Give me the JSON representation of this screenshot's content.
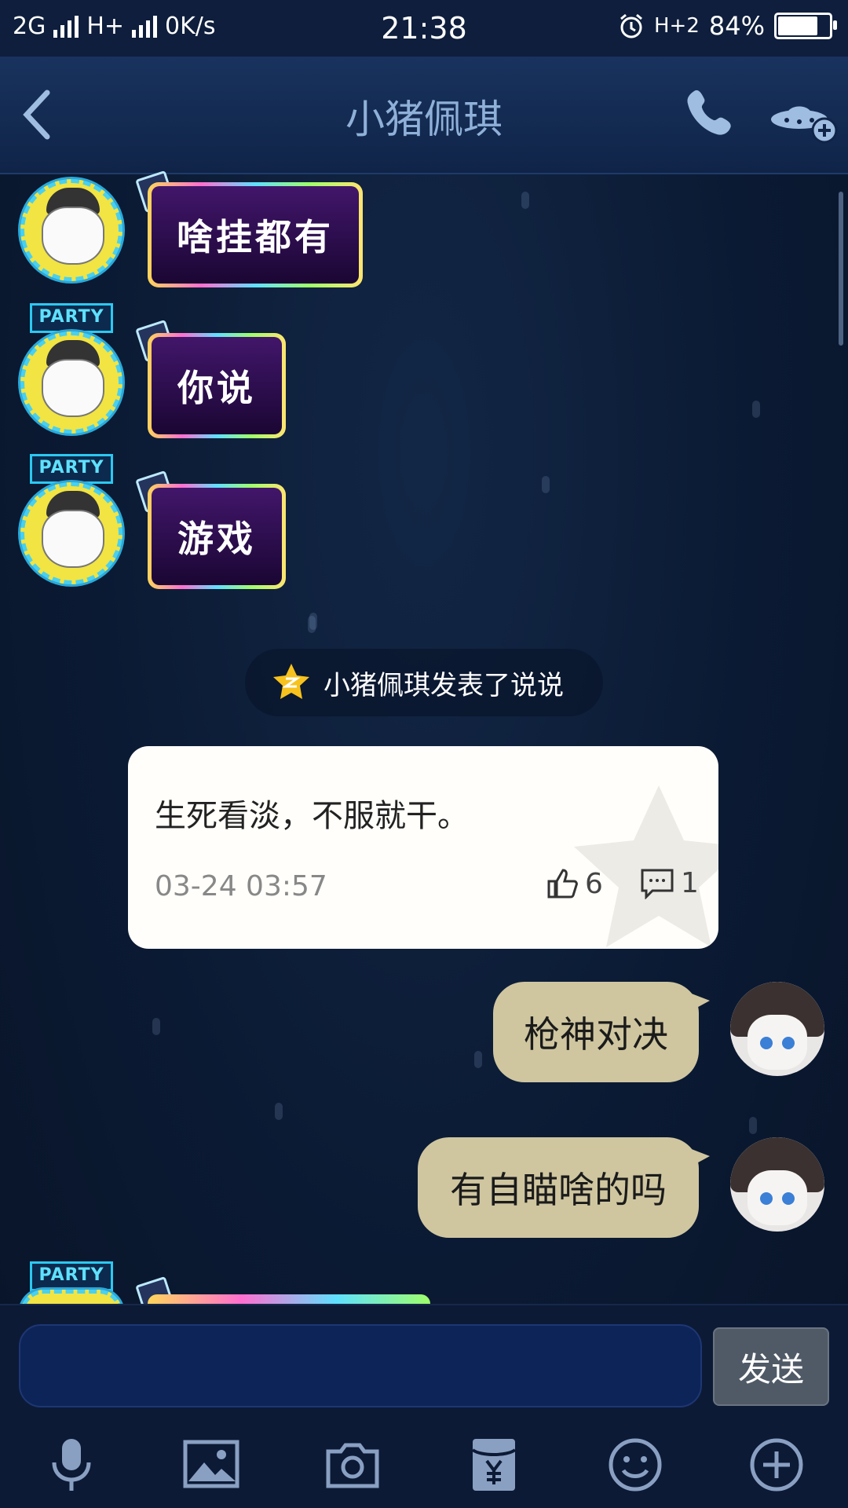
{
  "status_bar": {
    "network1": "2G",
    "network2": "H+",
    "speed": "0K/s",
    "time": "21:38",
    "network3": "H+2",
    "battery": "84%",
    "battery_level": 0.84
  },
  "header": {
    "title": "小猪佩琪",
    "back_icon": "chevron-left-icon",
    "call_icon": "phone-icon",
    "more_icon": "ufo-add-icon"
  },
  "messages": [
    {
      "side": "left",
      "badge": "",
      "text": "啥挂都有"
    },
    {
      "side": "left",
      "badge": "PARTY",
      "text": "你说"
    },
    {
      "side": "left",
      "badge": "PARTY",
      "text": "游戏"
    }
  ],
  "notice": {
    "text": "小猪佩琪发表了说说",
    "icon": "qzone-star-icon"
  },
  "shuoshuo": {
    "text": "生死看淡，不服就干。",
    "time": "03-24 03:57",
    "likes": "6",
    "comments": "1"
  },
  "my_messages": [
    {
      "text": "枪神对决"
    },
    {
      "text": "有自瞄啥的吗"
    }
  ],
  "partial_message": {
    "badge": "PARTY"
  },
  "input": {
    "placeholder": "",
    "send_label": "发送"
  },
  "toolbar": [
    "microphone-icon",
    "image-icon",
    "camera-icon",
    "red-packet-icon",
    "emoji-icon",
    "plus-icon"
  ],
  "colors": {
    "bubble_mine": "#cfc6a0",
    "background": "#0b1a33",
    "neon_bubble": "#42166b"
  }
}
